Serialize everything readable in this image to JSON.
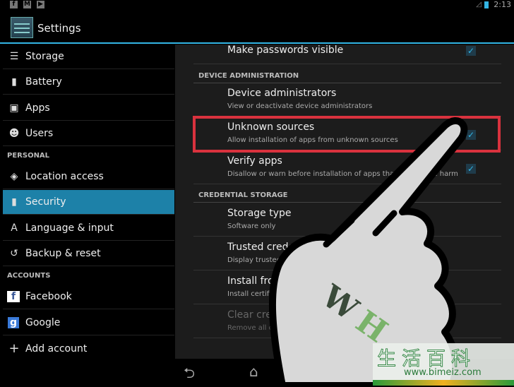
{
  "status_bar": {
    "time": "2:13",
    "notification_icons": [
      "facebook-icon",
      "gmail-icon",
      "play-store-icon"
    ]
  },
  "action_bar": {
    "title": "Settings"
  },
  "sidebar": {
    "items": [
      {
        "label": "Storage",
        "icon": "storage-icon",
        "glyph": "☰"
      },
      {
        "label": "Battery",
        "icon": "battery-icon",
        "glyph": "▮"
      },
      {
        "label": "Apps",
        "icon": "apps-icon",
        "glyph": "▣"
      },
      {
        "label": "Users",
        "icon": "users-icon",
        "glyph": "☻"
      },
      {
        "label": "Location access",
        "icon": "location-icon",
        "glyph": "◈"
      },
      {
        "label": "Security",
        "icon": "lock-icon",
        "glyph": "🔒"
      },
      {
        "label": "Language & input",
        "icon": "language-icon",
        "glyph": "A"
      },
      {
        "label": "Backup & reset",
        "icon": "backup-icon",
        "glyph": "↺"
      },
      {
        "label": "Facebook",
        "icon": "facebook-icon",
        "glyph": "f"
      },
      {
        "label": "Google",
        "icon": "google-icon",
        "glyph": "g"
      },
      {
        "label": "Add account",
        "icon": "plus-icon",
        "glyph": "+"
      }
    ],
    "headers": {
      "personal": "PERSONAL",
      "accounts": "ACCOUNTS"
    },
    "selected": "Security"
  },
  "security": {
    "make_passwords_visible": {
      "title": "Make passwords visible",
      "checked": true
    },
    "device_admin_header": "DEVICE ADMINISTRATION",
    "device_administrators": {
      "title": "Device administrators",
      "summary": "View or deactivate device administrators"
    },
    "unknown_sources": {
      "title": "Unknown sources",
      "summary": "Allow installation of apps from unknown sources",
      "checked": true
    },
    "verify_apps": {
      "title": "Verify apps",
      "summary": "Disallow or warn before installation of apps that may cause harm",
      "checked": true
    },
    "credential_header": "CREDENTIAL STORAGE",
    "storage_type": {
      "title": "Storage type",
      "summary": "Software only"
    },
    "trusted_credentials": {
      "title": "Trusted credentials",
      "summary": "Display trusted CA certificates"
    },
    "install_from_storage": {
      "title": "Install from storage",
      "summary": "Install certificates from storage"
    },
    "clear_credentials": {
      "title": "Clear credentials",
      "summary": "Remove all certificates",
      "disabled": true
    }
  },
  "watermark": {
    "logo": "wH",
    "chinese": "生活百科",
    "url": "www.bimeiz.com"
  },
  "colors": {
    "accent": "#33b5e5",
    "selected": "#1d81a8",
    "highlight_box": "#d9323e"
  }
}
